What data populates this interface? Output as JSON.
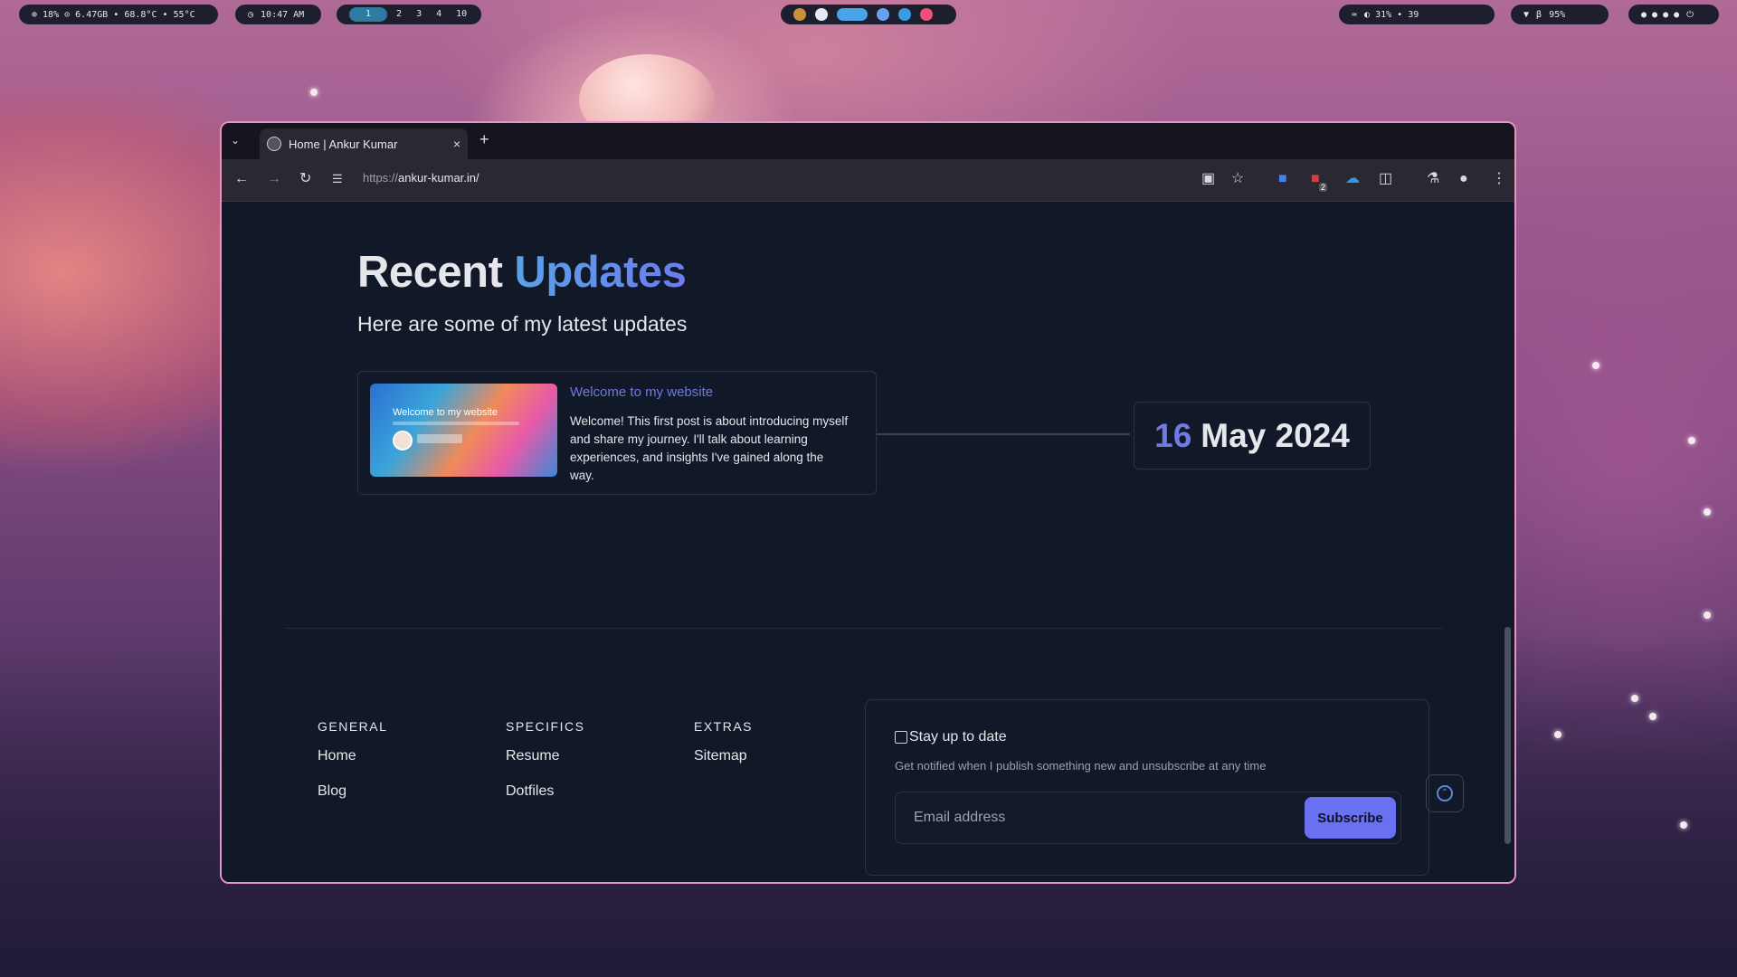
{
  "topbar": {
    "system_stats": "⊚ 18% ⊙ 6.47GB • 68.8°C • 55°C",
    "clock": "10:47 AM",
    "workspaces": [
      "1",
      "2",
      "3",
      "4",
      "10"
    ],
    "active_workspace": "1",
    "status_right": "◐ 31%  • 39",
    "battery": "95%"
  },
  "browser": {
    "tab_title": "Home | Ankur Kumar",
    "url_scheme": "https://",
    "url_host": "ankur-kumar.in/",
    "extension_badge": "2"
  },
  "page": {
    "heading_plain": "Recent",
    "heading_accent": "Updates",
    "subtitle": "Here are some of my latest updates",
    "posts": [
      {
        "thumbnail_title": "Welcome to my website",
        "title": "Welcome to my website",
        "excerpt": "Welcome! This first post is about introducing myself and share my journey. I'll talk about learning experiences, and insights I've gained along the way.",
        "date_day": "16",
        "date_rest": "May 2024"
      }
    ],
    "footer": {
      "columns": [
        {
          "heading": "GENERAL",
          "links": [
            "Home",
            "Blog"
          ]
        },
        {
          "heading": "SPECIFICS",
          "links": [
            "Resume",
            "Dotfiles"
          ]
        },
        {
          "heading": "EXTRAS",
          "links": [
            "Sitemap"
          ]
        }
      ],
      "newsletter": {
        "title": "Stay up to date",
        "description": "Get notified when I publish something new and unsubscribe at any time",
        "placeholder": "Email address",
        "button": "Subscribe"
      }
    }
  },
  "colors": {
    "accent": "#6f7ae6",
    "page_bg": "#111827",
    "window_border": "#e595c2",
    "button": "#6a70f2"
  }
}
